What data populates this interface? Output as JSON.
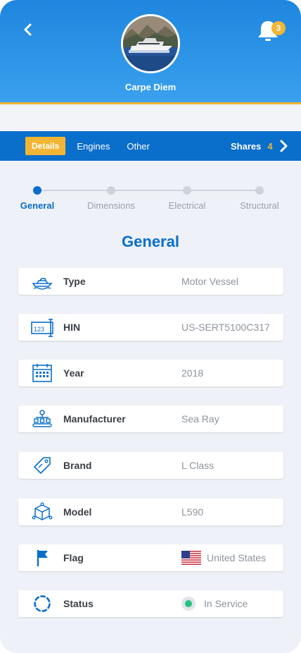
{
  "header": {
    "vessel_name": "Carpe Diem",
    "notification_count": "3",
    "accent_color": "#f2b534",
    "header_color": "#1e86de"
  },
  "tabs": {
    "items": [
      {
        "label": "Details",
        "active": true
      },
      {
        "label": "Engines",
        "active": false
      },
      {
        "label": "Other",
        "active": false
      }
    ],
    "shares_label": "Shares",
    "shares_count": "4"
  },
  "stepper": {
    "steps": [
      {
        "label": "General",
        "active": true
      },
      {
        "label": "Dimensions",
        "active": false
      },
      {
        "label": "Electrical",
        "active": false
      },
      {
        "label": "Structural",
        "active": false
      }
    ]
  },
  "section_title": "General",
  "rows": [
    {
      "icon": "boat-icon",
      "label": "Type",
      "value": "Motor Vessel"
    },
    {
      "icon": "hin-icon",
      "label": "HIN",
      "value": "US-SERT5100C317"
    },
    {
      "icon": "calendar-icon",
      "label": "Year",
      "value": "2018"
    },
    {
      "icon": "factory-icon",
      "label": "Manufacturer",
      "value": "Sea Ray"
    },
    {
      "icon": "tag-icon",
      "label": "Brand",
      "value": "L Class"
    },
    {
      "icon": "cube-icon",
      "label": "Model",
      "value": "L590"
    },
    {
      "icon": "flag-icon",
      "label": "Flag",
      "value": "United States"
    },
    {
      "icon": "status-ring-icon",
      "label": "Status",
      "value": "In Service"
    }
  ],
  "status_color": "#27c281",
  "icon_color": "#0a6ecb"
}
